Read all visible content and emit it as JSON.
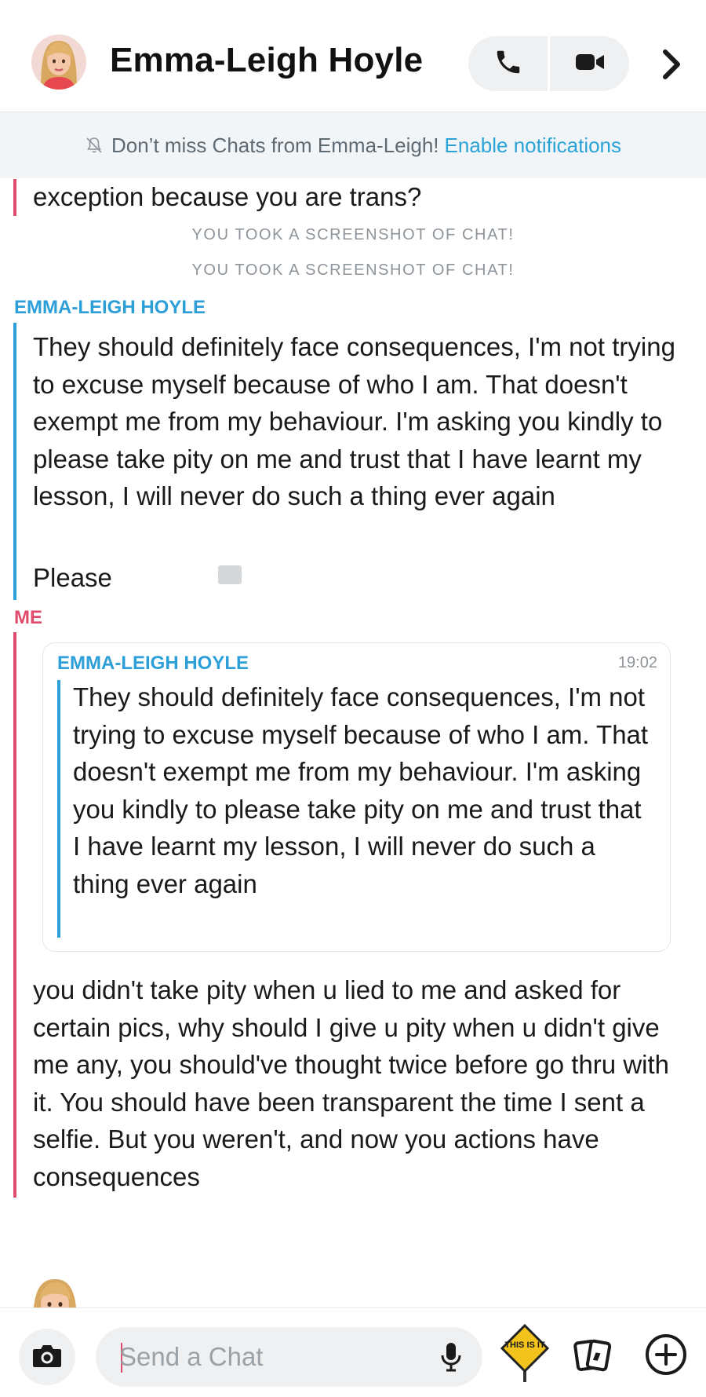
{
  "header": {
    "contact_name": "Emma-Leigh Hoyle",
    "avatar_icon": "bitmoji-avatar",
    "call_icon": "phone-icon",
    "video_icon": "video-camera-icon",
    "more_icon": "chevron-right-icon"
  },
  "banner": {
    "text": "Don’t miss Chats from Emma-Leigh!",
    "link": "Enable notifications",
    "icon": "bell-off-icon"
  },
  "chat": {
    "partial_message": "exception because you are trans?",
    "system_1": "YOU TOOK A SCREENSHOT OF CHAT!",
    "system_2": "YOU TOOK A SCREENSHOT OF CHAT!",
    "block_1": {
      "sender": "EMMA-LEIGH HOYLE",
      "message_1": "They should definitely face consequences, I'm not trying to excuse myself because of who I am. That doesn't exempt me from my behaviour. I'm asking you kindly to please take pity on me and trust that I have learnt my lesson, I will never do such a thing ever again",
      "message_2": "Please"
    },
    "block_2": {
      "sender": "ME",
      "quote": {
        "sender": "EMMA-LEIGH HOYLE",
        "time": "19:02",
        "text": "They should definitely face consequences, I'm not trying to excuse myself because of who I am. That doesn't exempt me from my behaviour. I'm asking you kindly to please take pity on me and trust that I have learnt my lesson, I will never do such a thing ever again"
      },
      "message": "you didn't take pity when u lied to me and asked for certain pics, why should I give u pity when u didn't give me any, you should've thought twice before go thru with it. You should have been transparent the time I sent a selfie. But you weren't, and now you actions have consequences"
    }
  },
  "composer": {
    "placeholder": "Send a Chat",
    "camera_icon": "camera-icon",
    "mic_icon": "microphone-icon",
    "sticker_text": "THIS IS IT",
    "cards_icon": "cards-icon",
    "plus_icon": "plus-circle-icon"
  },
  "colors": {
    "me": "#e04b6b",
    "friend": "#2c9fd8",
    "link": "#2aa3d6",
    "system": "#8d949a"
  }
}
